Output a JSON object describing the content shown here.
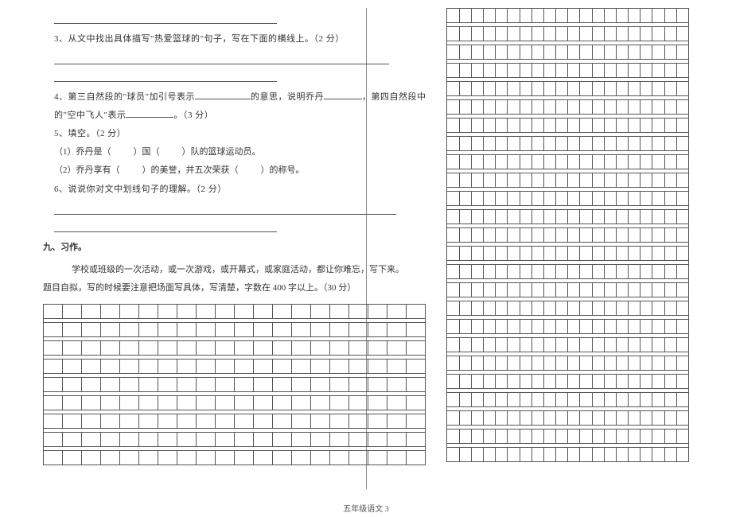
{
  "left": {
    "q3": "3、从文中找出具体描写\"热爱篮球的\"句子，写在下面的横线上。（2 分）",
    "q4_a": "4、第三自然段的\"球员\"加引号表示",
    "q4_b": "的意思，说明乔丹",
    "q4_c": "，第四自然段中",
    "q4_d": "的\"空中飞人\"表示",
    "q4_e": "。（3 分）",
    "q5": "5、填空。（2 分）",
    "q5_1a": "（1）乔丹是（",
    "q5_1b": "）国（",
    "q5_1c": "）队的篮球运动员。",
    "q5_2a": "（2）乔丹享有（",
    "q5_2b": "）的美誉，并五次荣获（",
    "q5_2c": "）的称号。",
    "q6": "6、说说你对文中划线句子的理解。（2 分）",
    "section9_title": "九、习作。",
    "essay_p1": "学校或班级的一次活动，或一次游戏，或开幕式，或家庭活动，都让你难忘，写下来。",
    "essay_p2": "题目自拟，写的时候要注意把场面写具体，写清楚，字数在 400 字以上。（30 分）"
  },
  "grid": {
    "cols": 20,
    "left_rows": 9,
    "right_rows": 25
  },
  "footer": "五年级语文 3"
}
